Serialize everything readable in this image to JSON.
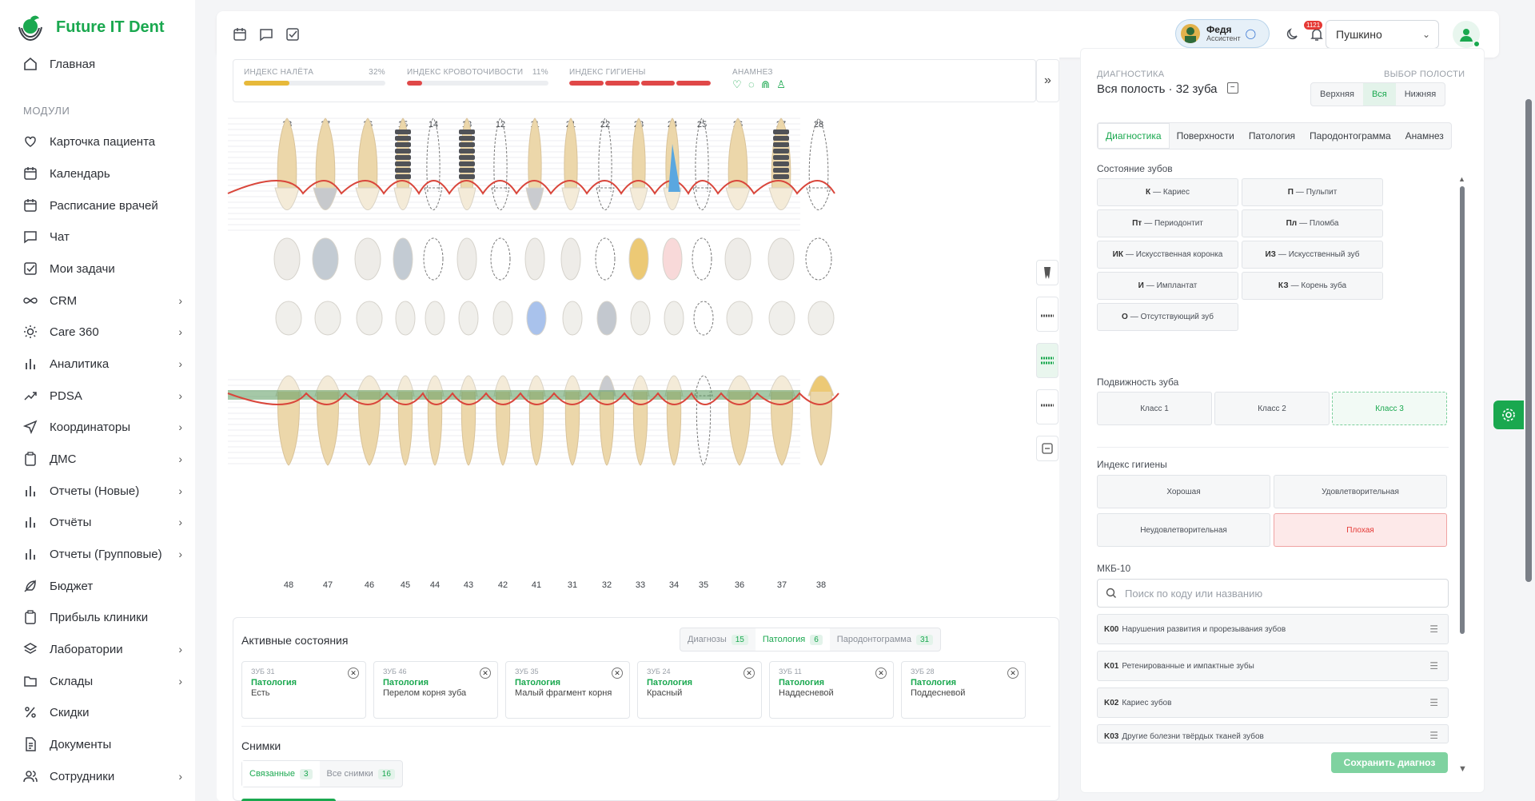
{
  "app": {
    "name": "Future IT Dent"
  },
  "sidebar": {
    "home": "Главная",
    "section": "МОДУЛИ",
    "items": [
      {
        "label": "Карточка пациента",
        "icon": "heart-icon",
        "chev": false
      },
      {
        "label": "Календарь",
        "icon": "calendar-icon",
        "chev": false
      },
      {
        "label": "Расписание врачей",
        "icon": "calendar-icon",
        "chev": false
      },
      {
        "label": "Чат",
        "icon": "chat-icon",
        "chev": false
      },
      {
        "label": "Мои задачи",
        "icon": "checkbox-icon",
        "chev": false
      },
      {
        "label": "CRM",
        "icon": "infinity-icon",
        "chev": true
      },
      {
        "label": "Care 360",
        "icon": "sun-icon",
        "chev": true
      },
      {
        "label": "Аналитика",
        "icon": "bar-chart-icon",
        "chev": true
      },
      {
        "label": "PDSA",
        "icon": "trend-icon",
        "chev": true
      },
      {
        "label": "Координаторы",
        "icon": "send-icon",
        "chev": true
      },
      {
        "label": "ДМС",
        "icon": "clipboard-icon",
        "chev": true
      },
      {
        "label": "Отчеты (Новые)",
        "icon": "bar-chart-icon",
        "chev": true
      },
      {
        "label": "Отчёты",
        "icon": "bar-chart-icon",
        "chev": true
      },
      {
        "label": "Отчеты (Групповые)",
        "icon": "bar-chart-icon",
        "chev": true
      },
      {
        "label": "Бюджет",
        "icon": "feather-icon",
        "chev": false
      },
      {
        "label": "Прибыль клиники",
        "icon": "clipboard-icon",
        "chev": false
      },
      {
        "label": "Лаборатории",
        "icon": "layers-icon",
        "chev": true
      },
      {
        "label": "Склады",
        "icon": "folder-icon",
        "chev": true
      },
      {
        "label": "Скидки",
        "icon": "percent-icon",
        "chev": false
      },
      {
        "label": "Документы",
        "icon": "document-icon",
        "chev": false
      },
      {
        "label": "Сотрудники",
        "icon": "users-icon",
        "chev": true
      }
    ]
  },
  "header": {
    "user_name": "Федя",
    "user_role": "Ассистент",
    "notifications": "1121",
    "clinic": "Пушкино"
  },
  "indices": [
    {
      "label": "ИНДЕКС НАЛЁТА",
      "pct": "32%",
      "value": 0.32,
      "color": "#e7b93a"
    },
    {
      "label": "ИНДЕКС КРОВОТОЧИВОСТИ",
      "pct": "11%",
      "value": 0.11,
      "color": "#e04848"
    },
    {
      "label": "ИНДЕКС ГИГИЕНЫ",
      "pct": "",
      "value": 1.0,
      "color": "#e04848"
    },
    {
      "label": "АНАМНЕЗ",
      "pct": ""
    }
  ],
  "teeth": {
    "upper": [
      "18",
      "17",
      "16",
      "15",
      "14",
      "13",
      "12",
      "11",
      "21",
      "22",
      "23",
      "24",
      "25",
      "26",
      "27",
      "28"
    ],
    "lower": [
      "48",
      "47",
      "46",
      "45",
      "44",
      "43",
      "42",
      "41",
      "31",
      "32",
      "33",
      "34",
      "35",
      "36",
      "37",
      "38"
    ]
  },
  "active_states": {
    "title": "Активные состояния",
    "tabs": [
      {
        "label": "Диагнозы",
        "count": "15"
      },
      {
        "label": "Патология",
        "count": "6"
      },
      {
        "label": "Пародонтограмма",
        "count": "31"
      }
    ],
    "cards": [
      {
        "tooth": "ЗУБ 31",
        "type": "Патология",
        "text": "Есть"
      },
      {
        "tooth": "ЗУБ 46",
        "type": "Патология",
        "text": "Перелом корня зуба"
      },
      {
        "tooth": "ЗУБ 35",
        "type": "Патология",
        "text": "Малый фрагмент корня"
      },
      {
        "tooth": "ЗУБ 24",
        "type": "Патология",
        "text": "Красный"
      },
      {
        "tooth": "ЗУБ 11",
        "type": "Патология",
        "text": "Наддесневой"
      },
      {
        "tooth": "ЗУБ 28",
        "type": "Патология",
        "text": "Поддесневой"
      }
    ]
  },
  "snapshots": {
    "title": "Снимки",
    "tabs": [
      {
        "label": "Связанные",
        "count": "3"
      },
      {
        "label": "Все снимки",
        "count": "16"
      }
    ]
  },
  "diagnostics": {
    "label": "ДИАГНОСТИКА",
    "title": "Вся полость · 32 зуба",
    "jaw_label": "ВЫБОР ПОЛОСТИ",
    "jaw": [
      "Верхняя",
      "Вся",
      "Нижняя"
    ],
    "tabs": [
      "Диагностика",
      "Поверхности",
      "Патология",
      "Пародонтограмма",
      "Анамнез"
    ],
    "state_title": "Состояние зубов",
    "states": [
      {
        "code": "К",
        "name": "Кариес"
      },
      {
        "code": "П",
        "name": "Пульпит"
      },
      {
        "code": "Пт",
        "name": "Периодонтит"
      },
      {
        "code": "Пл",
        "name": "Пломба"
      },
      {
        "code": "ИК",
        "name": "Искусственная коронка"
      },
      {
        "code": "ИЗ",
        "name": "Искусственный зуб"
      },
      {
        "code": "И",
        "name": "Имплантат"
      },
      {
        "code": "КЗ",
        "name": "Корень зуба"
      },
      {
        "code": "О",
        "name": "Отсутствующий зуб"
      }
    ],
    "mobility_title": "Подвижность зуба",
    "mobility": [
      "Класс 1",
      "Класс 2",
      "Класс 3"
    ],
    "hygiene_title": "Индекс гигиены",
    "hygiene": [
      "Хорошая",
      "Удовлетворительная",
      "Неудовлетворительная",
      "Плохая"
    ],
    "mkb_title": "МКБ-10",
    "search_placeholder": "Поиск по коду или названию",
    "mkb": [
      {
        "code": "K00",
        "name": "Нарушения развития и прорезывания зубов"
      },
      {
        "code": "K01",
        "name": "Ретенированные и импактные зубы"
      },
      {
        "code": "K02",
        "name": "Кариес зубов"
      },
      {
        "code": "K03",
        "name": "Другие болезни твёрдых тканей зубов"
      }
    ],
    "save": "Сохранить диагноз"
  }
}
